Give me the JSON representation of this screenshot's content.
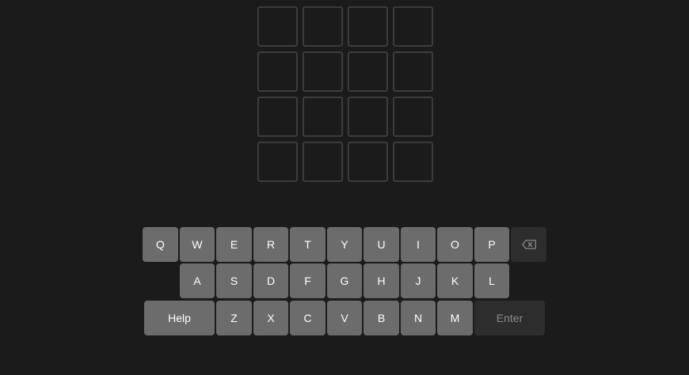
{
  "board": {
    "rows": 4,
    "cols": 4,
    "tiles": [
      [
        "",
        "",
        "",
        ""
      ],
      [
        "",
        "",
        "",
        ""
      ],
      [
        "",
        "",
        "",
        ""
      ],
      [
        "",
        "",
        "",
        ""
      ]
    ]
  },
  "keyboard": {
    "row1": [
      "Q",
      "W",
      "E",
      "R",
      "T",
      "Y",
      "U",
      "I",
      "O",
      "P"
    ],
    "row2": [
      "A",
      "S",
      "D",
      "F",
      "G",
      "H",
      "J",
      "K",
      "L"
    ],
    "row3": [
      "Z",
      "X",
      "C",
      "V",
      "B",
      "N",
      "M"
    ],
    "help_label": "Help",
    "enter_label": "Enter",
    "backspace_icon": "backspace-icon"
  },
  "colors": {
    "background": "#1b1b1b",
    "tile_border": "#3c3c3c",
    "key": "#6c6c6c",
    "key_dark": "#2d2d2d"
  }
}
